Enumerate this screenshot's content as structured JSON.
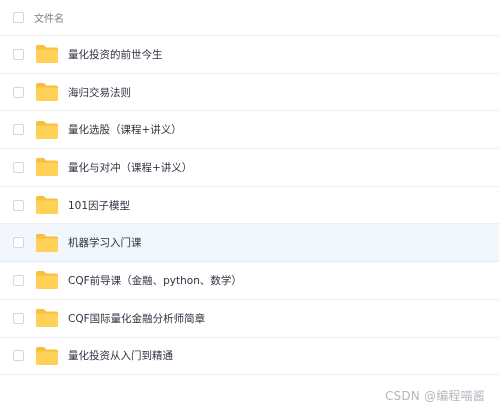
{
  "header": {
    "column_label": "文件名"
  },
  "files": [
    {
      "name": "量化投资的前世今生",
      "icon": "folder-icon"
    },
    {
      "name": "海归交易法则",
      "icon": "folder-icon"
    },
    {
      "name": "量化选股（课程+讲义）",
      "icon": "folder-icon"
    },
    {
      "name": "量化与对冲（课程+讲义）",
      "icon": "folder-icon"
    },
    {
      "name": "101因子模型",
      "icon": "folder-icon"
    },
    {
      "name": "机器学习入门课",
      "icon": "folder-icon",
      "hovered": true
    },
    {
      "name": "CQF前导课（金融、python、数学）",
      "icon": "folder-icon"
    },
    {
      "name": "CQF国际量化金融分析师简章",
      "icon": "folder-icon"
    },
    {
      "name": "量化投资从入门到精通",
      "icon": "folder-icon"
    }
  ],
  "watermark": "CSDN @编程喵酱",
  "colors": {
    "folder": "#ffd157",
    "folder_tab": "#f7bf3c",
    "row_hover": "#f1f7fd"
  }
}
